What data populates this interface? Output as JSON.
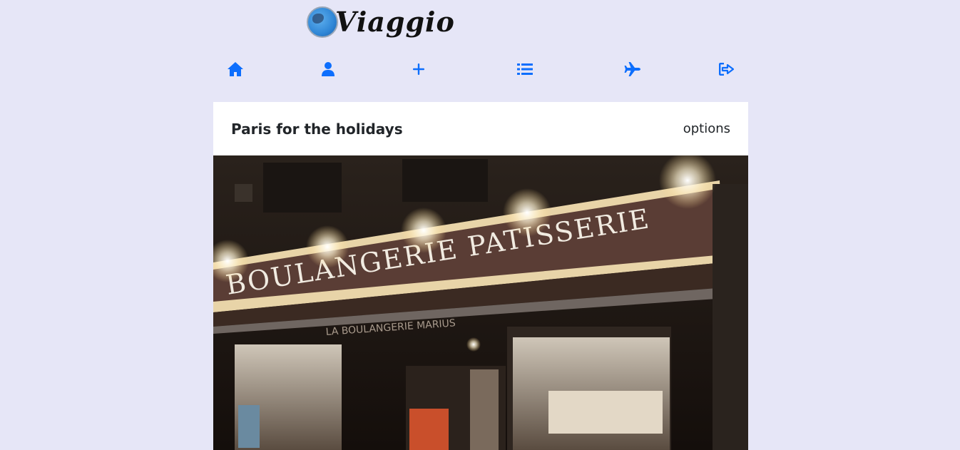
{
  "brand": {
    "name": "Viaggio"
  },
  "nav": {
    "items": [
      {
        "icon": "home-icon"
      },
      {
        "icon": "user-icon"
      },
      {
        "icon": "plus-icon"
      },
      {
        "icon": "list-icon"
      },
      {
        "icon": "plane-icon"
      },
      {
        "icon": "logout-icon"
      }
    ],
    "icon_color": "#0d6efd"
  },
  "post": {
    "title": "Paris for the holidays",
    "options_label": "options",
    "photo": {
      "sign_text": "BOULANGERIE PATISSERIE",
      "awning_text": "LA BOULANGERIE MARIUS"
    }
  },
  "colors": {
    "background": "#e6e6f7",
    "card": "#ffffff",
    "accent": "#0d6efd"
  }
}
